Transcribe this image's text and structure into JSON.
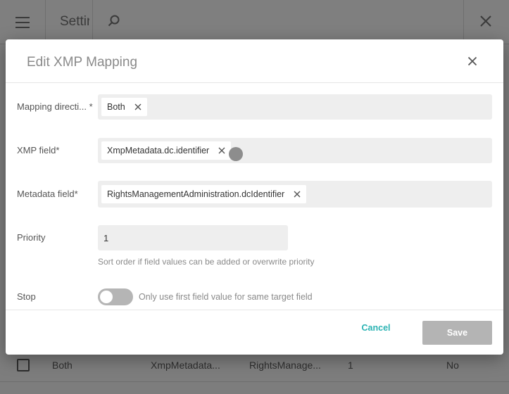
{
  "background": {
    "title": "Settir",
    "row": {
      "direction": "Both",
      "xmp_field": "XmpMetadata...",
      "metadata_field": "RightsManage...",
      "priority": "1",
      "stop": "No"
    }
  },
  "dialog": {
    "title": "Edit XMP Mapping",
    "fields": {
      "mapping_direction": {
        "label": "Mapping directi... *",
        "value": "Both"
      },
      "xmp_field": {
        "label": "XMP field*",
        "value": "XmpMetadata.dc.identifier"
      },
      "metadata_field": {
        "label": "Metadata field*",
        "value": "RightsManagementAdministration.dcIdentifier"
      },
      "priority": {
        "label": "Priority",
        "value": "1",
        "hint": "Sort order if field values can be added or overwrite priority"
      },
      "stop": {
        "label": "Stop",
        "toggle_label": "Only use first field value for same target field",
        "enabled": false
      }
    },
    "actions": {
      "cancel": "Cancel",
      "save": "Save"
    }
  },
  "colors": {
    "accent": "#2bb3b3",
    "save_disabled": "#b4b4b4"
  },
  "icons": [
    "menu-icon",
    "search-icon",
    "close-icon"
  ]
}
